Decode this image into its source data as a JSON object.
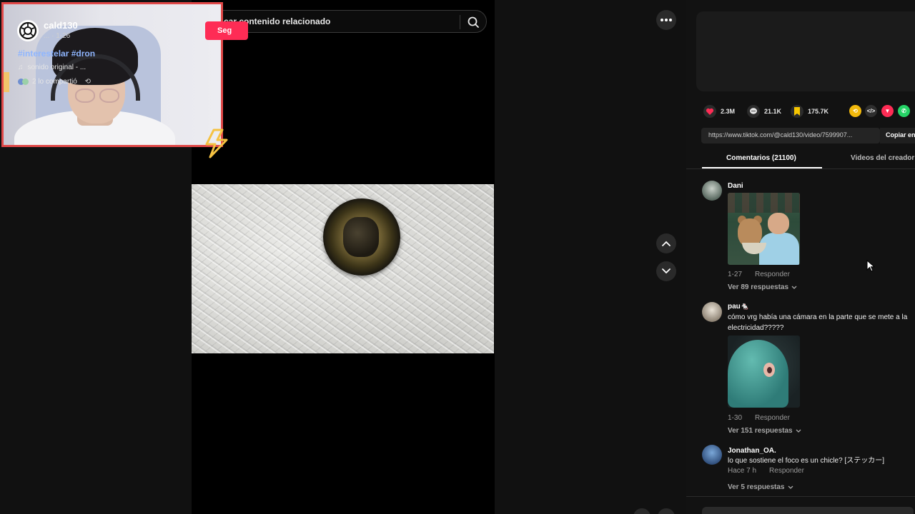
{
  "search": {
    "text": "car contenido relacionado"
  },
  "author": {
    "username": "cald130",
    "meta": "... · 1-26",
    "follow_label": "Seg"
  },
  "description": {
    "hashtags": "#interestelar #dron",
    "music": "sonido original - ...",
    "shared": "2 lo compartió"
  },
  "stats": {
    "likes": "2.3M",
    "comments": "21.1K",
    "saves": "175.7K"
  },
  "share_icons": [
    "repost-icon",
    "embed-icon",
    "direct-send-icon",
    "whatsapp-icon"
  ],
  "link": {
    "url": "https://www.tiktok.com/@cald130/video/7599907...",
    "copy_label": "Copiar en"
  },
  "tabs": [
    {
      "label": "Comentarios (21100)"
    },
    {
      "label": "Videos del creador"
    }
  ],
  "comments": [
    {
      "user": "Dani",
      "text": "",
      "date": "1-27",
      "reply": "Responder",
      "replies": "Ver 89 respuestas"
    },
    {
      "user": "pau🐁",
      "text": "cómo vrg había una cámara en la parte que se mete a la electricidad?????",
      "date": "1-30",
      "reply": "Responder",
      "replies": "Ver 151 respuestas"
    },
    {
      "user": "Jonathan_OA.",
      "text": "lo que sostiene el foco es un chicle? [ステッカー]",
      "date": "Hace 7 h",
      "reply": "Responder",
      "replies": "Ver 5 respuestas"
    }
  ],
  "colors": {
    "follow": "#fe2c55",
    "hashtag": "#8fb6ff",
    "webcam_border": "#e04848",
    "like": "#fe2c55",
    "save": "#f7c600"
  }
}
